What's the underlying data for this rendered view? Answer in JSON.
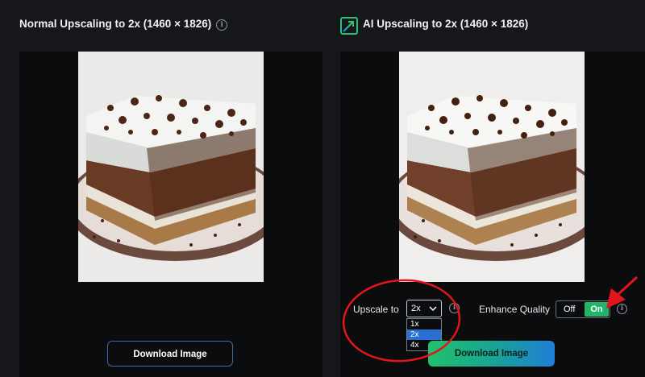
{
  "left": {
    "title": "Normal Upscaling to 2x (1460 × 1826)",
    "info_glyph": "i",
    "download_label": "Download Image"
  },
  "right": {
    "title": "AI Upscaling to 2x (1460 × 1826)",
    "info_glyph": "i",
    "download_label": "Download Image",
    "upscale_label": "Upscale to",
    "upscale_value": "2x",
    "upscale_options": [
      "1x",
      "2x",
      "4x"
    ],
    "upscale_selected": "2x",
    "enhance_label": "Enhance Quality",
    "toggle_off": "Off",
    "toggle_on": "On",
    "enhance_state": "On"
  },
  "colors": {
    "accent_green": "#21b56b",
    "accent_blue": "#2b6fd2",
    "annotation_red": "#e4141c"
  },
  "icons": [
    "info-icon",
    "ai-upscale-icon",
    "chevron-down-icon",
    "red-arrow-annotation",
    "red-circle-annotation"
  ]
}
